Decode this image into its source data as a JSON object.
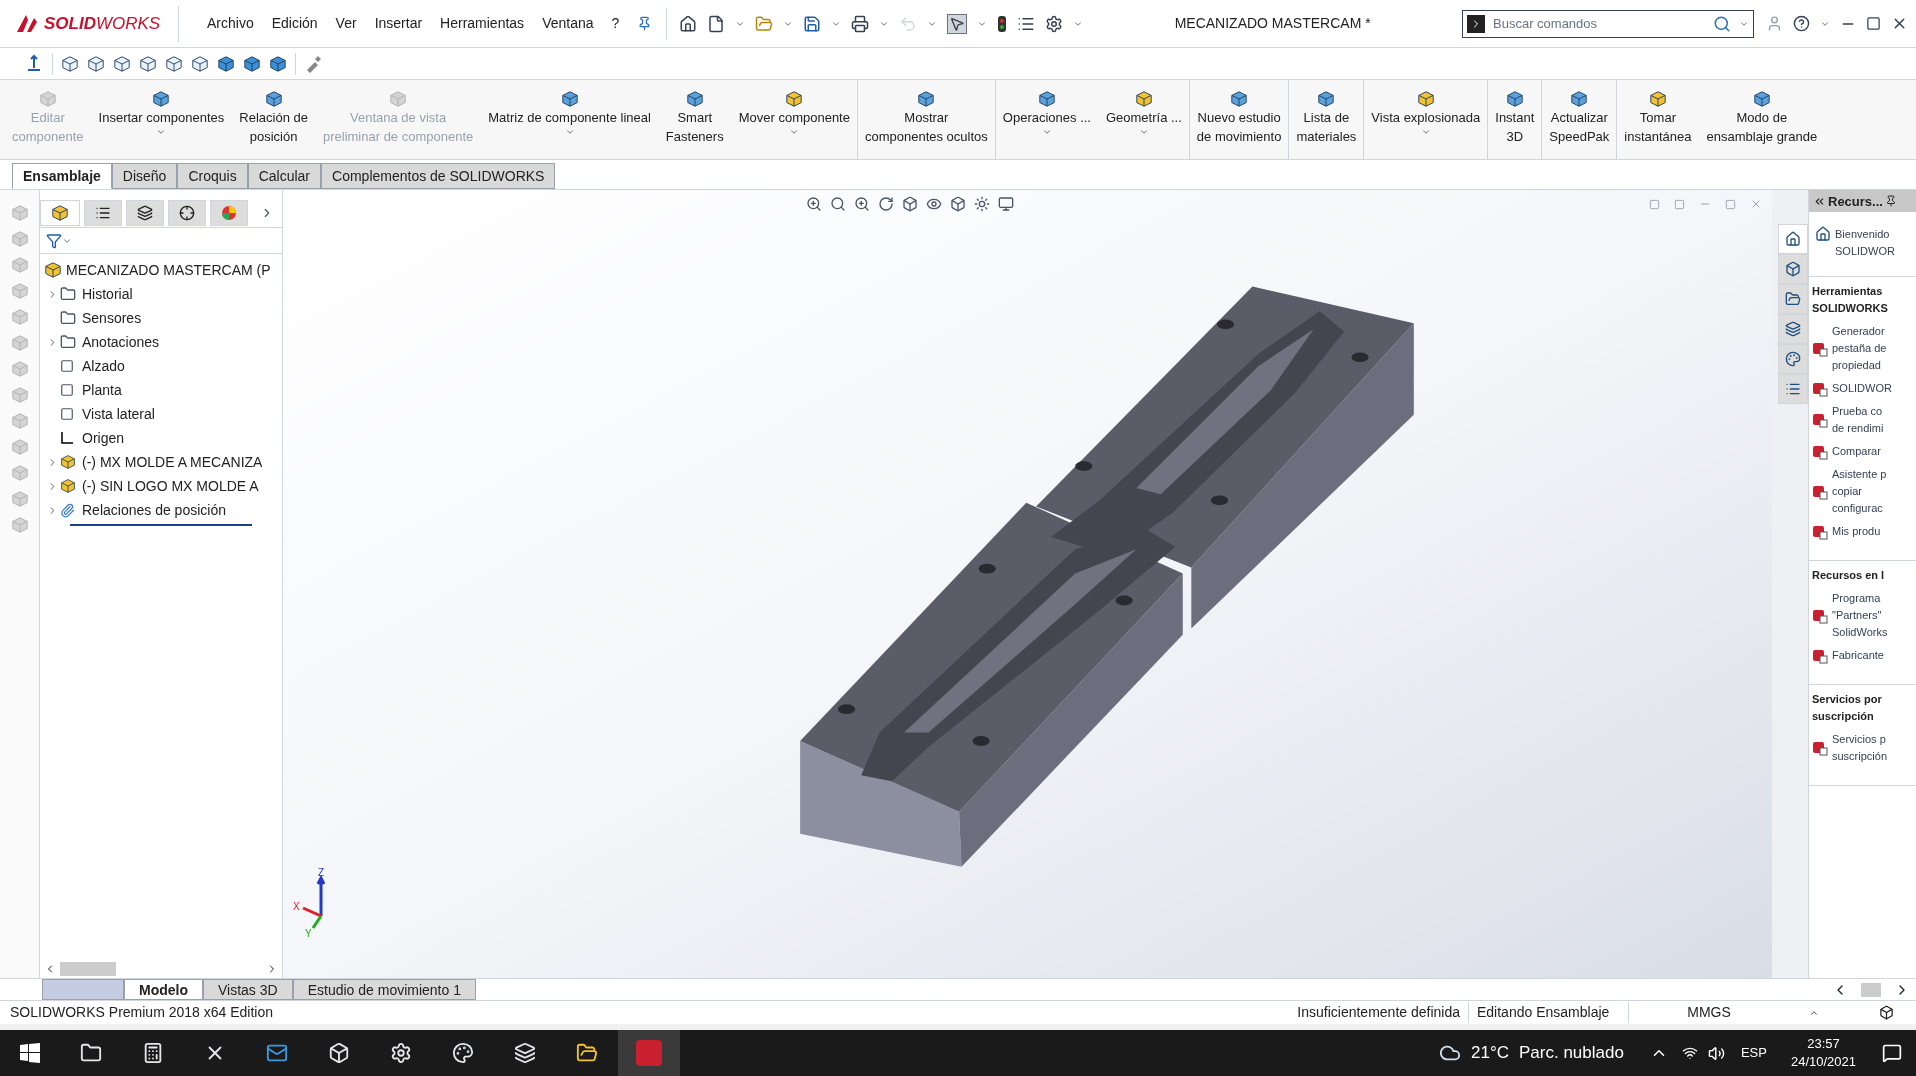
{
  "app": {
    "logo": "**SOLID**WORKS",
    "title": "MECANIZADO MASTERCAM *"
  },
  "menu": [
    "Archivo",
    "Edición",
    "Ver",
    "Insertar",
    "Herramientas",
    "Ventana",
    "?"
  ],
  "search": {
    "placeholder": "Buscar comandos"
  },
  "commands": [
    {
      "lines": [
        "Editar",
        "componente"
      ],
      "disabled": true,
      "dropdown": false,
      "separator": false
    },
    {
      "lines": [
        "Insertar componentes"
      ],
      "disabled": false,
      "dropdown": true,
      "separator": false
    },
    {
      "lines": [
        "Relación de",
        "posición"
      ],
      "disabled": false,
      "dropdown": false,
      "separator": false
    },
    {
      "lines": [
        "Ventana de vista",
        "preliminar de componente"
      ],
      "disabled": true,
      "dropdown": false,
      "separator": false
    },
    {
      "lines": [
        "Matriz de componente lineal"
      ],
      "disabled": false,
      "dropdown": true,
      "separator": false
    },
    {
      "lines": [
        "Smart",
        "Fasteners"
      ],
      "disabled": false,
      "dropdown": false,
      "separator": false
    },
    {
      "lines": [
        "Mover componente"
      ],
      "disabled": false,
      "dropdown": true,
      "separator": false
    },
    {
      "lines": [
        "Mostrar",
        "componentes ocultos"
      ],
      "disabled": false,
      "dropdown": false,
      "separator": true
    },
    {
      "lines": [
        "Operaciones ..."
      ],
      "disabled": false,
      "dropdown": true,
      "separator": true
    },
    {
      "lines": [
        "Geometría ..."
      ],
      "disabled": false,
      "dropdown": true,
      "separator": false
    },
    {
      "lines": [
        "Nuevo estudio",
        "de movimiento"
      ],
      "disabled": false,
      "dropdown": false,
      "separator": true
    },
    {
      "lines": [
        "Lista de",
        "materiales"
      ],
      "disabled": false,
      "dropdown": false,
      "separator": true
    },
    {
      "lines": [
        "Vista explosionada"
      ],
      "disabled": false,
      "dropdown": true,
      "separator": true
    },
    {
      "lines": [
        "Instant",
        "3D"
      ],
      "disabled": false,
      "dropdown": false,
      "separator": true
    },
    {
      "lines": [
        "Actualizar",
        "SpeedPak"
      ],
      "disabled": false,
      "dropdown": false,
      "separator": true
    },
    {
      "lines": [
        "Tomar",
        "instantánea"
      ],
      "disabled": false,
      "dropdown": false,
      "separator": true
    },
    {
      "lines": [
        "Modo de",
        "ensamblaje grande"
      ],
      "disabled": false,
      "dropdown": false,
      "separator": false
    }
  ],
  "tabs": [
    {
      "label": "Ensamblaje",
      "selected": true
    },
    {
      "label": "Diseño",
      "selected": false
    },
    {
      "label": "Croquis",
      "selected": false
    },
    {
      "label": "Calcular",
      "selected": false
    },
    {
      "label": "Complementos de SOLIDWORKS",
      "selected": false
    }
  ],
  "tree": {
    "root": "MECANIZADO MASTERCAM  (P",
    "items": [
      {
        "label": "Historial",
        "kind": "group"
      },
      {
        "label": "Sensores",
        "kind": "leaf"
      },
      {
        "label": "Anotaciones",
        "kind": "group"
      },
      {
        "label": "Alzado",
        "kind": "leaf"
      },
      {
        "label": "Planta",
        "kind": "leaf"
      },
      {
        "label": "Vista lateral",
        "kind": "leaf"
      },
      {
        "label": "Origen",
        "kind": "leaf"
      },
      {
        "label": "(-) MX MOLDE A MECANIZA",
        "kind": "group"
      },
      {
        "label": "(-) SIN LOGO MX MOLDE A",
        "kind": "group"
      },
      {
        "label": "Relaciones de posición",
        "kind": "group"
      }
    ]
  },
  "triad": [
    "Z",
    "X",
    "Y"
  ],
  "task_pane": {
    "tabs": [
      {
        "selected": true
      },
      {
        "selected": false
      },
      {
        "selected": false
      },
      {
        "selected": false
      },
      {
        "selected": false
      },
      {
        "selected": false
      }
    ],
    "title": "Recurs...",
    "intro": [
      "Bienvenido",
      "SOLIDWOR"
    ],
    "sections": [
      {
        "title": [
          "Herramientas",
          "SOLIDWORKS"
        ],
        "items": [
          [
            "Generador",
            "pestaña de",
            "propiedad"
          ],
          [
            "SOLIDWOR"
          ],
          [
            "Prueba co",
            "de rendimi"
          ],
          [
            "Comparar"
          ],
          [
            "Asistente p",
            "copiar",
            "configurac"
          ],
          [
            "Mis produ"
          ]
        ]
      },
      {
        "title": [
          "Recursos en l"
        ],
        "items": [
          [
            "Programa",
            "\"Partners\"",
            "SolidWorks"
          ],
          [
            "Fabricante"
          ]
        ]
      },
      {
        "title": [
          "Servicios por",
          "suscripción"
        ],
        "items": [
          [
            "Servicios p",
            "suscripción"
          ]
        ]
      }
    ]
  },
  "bottom_tabs": [
    {
      "label": "Modelo",
      "selected": true
    },
    {
      "label": "Vistas 3D",
      "selected": false
    },
    {
      "label": "Estudio de movimiento 1",
      "selected": false
    }
  ],
  "status_bar": {
    "edition": "SOLIDWORKS Premium 2018 x64 Edition",
    "definition": "Insuficientemente definida",
    "mode": "Editando Ensamblaje",
    "units": "MMGS"
  },
  "taskbar": {
    "temperature": "21°C",
    "weather": "Parc. nublado",
    "language": "ESP",
    "time": "23:57",
    "date": "24/10/2021"
  }
}
